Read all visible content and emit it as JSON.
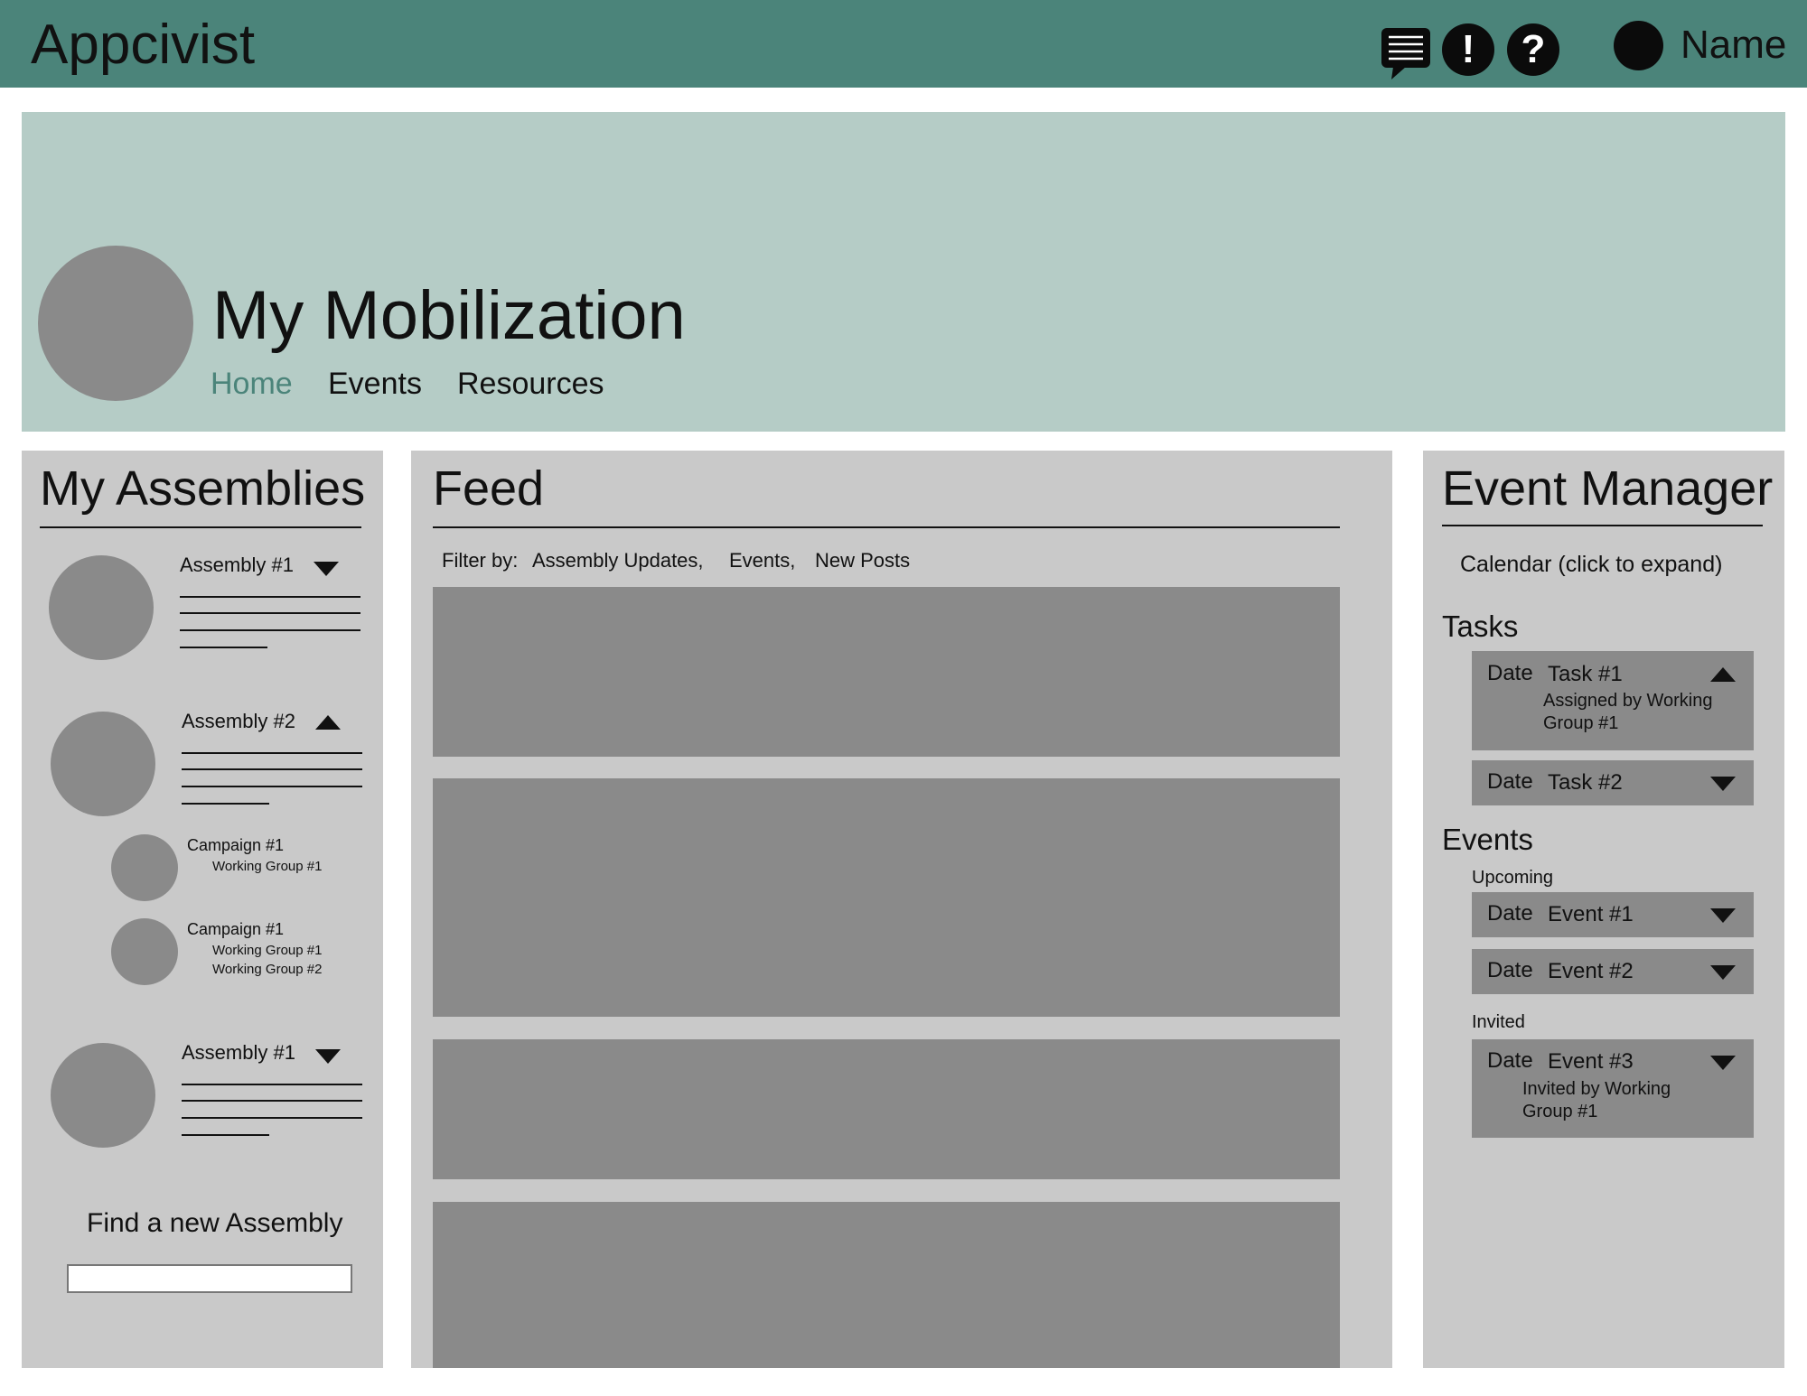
{
  "header": {
    "app_title": "Appcivist",
    "icons": [
      "chat-icon",
      "alert-icon",
      "help-icon"
    ],
    "user_name": "Name"
  },
  "banner": {
    "title": "My Mobilization",
    "tabs": [
      {
        "label": "Home",
        "active": true
      },
      {
        "label": "Events",
        "active": false
      },
      {
        "label": "Resources",
        "active": false
      }
    ]
  },
  "assemblies": {
    "title": "My Assemblies",
    "items": [
      {
        "name": "Assembly #1",
        "expanded": false
      },
      {
        "name": "Assembly #2",
        "expanded": true,
        "campaigns": [
          {
            "name": "Campaign #1",
            "groups": [
              "Working Group #1"
            ]
          },
          {
            "name": "Campaign #1",
            "groups": [
              "Working Group #1",
              "Working Group #2"
            ]
          }
        ]
      },
      {
        "name": "Assembly #1",
        "expanded": false
      }
    ],
    "find_label": "Find a new Assembly",
    "search_value": ""
  },
  "feed": {
    "title": "Feed",
    "filter_label": "Filter by:",
    "filters": [
      "Assembly Updates,",
      "Events,",
      "New Posts"
    ]
  },
  "event_manager": {
    "title": "Event Manager",
    "calendar_label": "Calendar (click to expand)",
    "tasks_heading": "Tasks",
    "tasks": [
      {
        "date": "Date",
        "name": "Task #1",
        "detail": "Assigned by Working Group #1",
        "expanded": true
      },
      {
        "date": "Date",
        "name": "Task #2",
        "expanded": false
      }
    ],
    "events_heading": "Events",
    "upcoming_label": "Upcoming",
    "upcoming": [
      {
        "date": "Date",
        "name": "Event #1",
        "expanded": false
      },
      {
        "date": "Date",
        "name": "Event #2",
        "expanded": false
      }
    ],
    "invited_label": "Invited",
    "invited": [
      {
        "date": "Date",
        "name": "Event #3",
        "detail": "Invited by Working Group #1",
        "expanded": false
      }
    ]
  },
  "colors": {
    "header_bg": "#4b847a",
    "banner_bg": "#b5ccc6",
    "panel_bg": "#c9c9c9",
    "placeholder_gray": "#8a8a8a",
    "active_tab": "#4b847a"
  }
}
